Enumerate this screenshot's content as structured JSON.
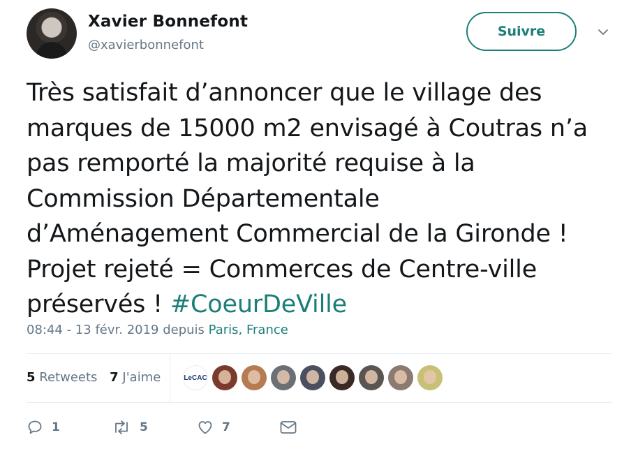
{
  "user": {
    "name": "Xavier Bonnefont",
    "handle": "@xavierbonnefont"
  },
  "follow_label": "Suivre",
  "tweet": {
    "text_lines": [
      "Très satisfait d’annoncer que le village des",
      "marques de 15000 m2 envisagé à Coutras n’a",
      "pas remporté la majorité requise à la",
      "Commission Départementale",
      "d’Aménagement Commercial de la Gironde !",
      "Projet rejeté = Commerces de Centre-ville",
      "préservés !"
    ],
    "hashtag": "#CoeurDeVille"
  },
  "meta": {
    "time": "08:44 - 13 févr. 2019 depuis ",
    "location": "Paris, France"
  },
  "stats": {
    "retweets_count": "5",
    "retweets_label": "Retweets",
    "likes_count": "7",
    "likes_label": "J'aime"
  },
  "likers": {
    "logo_text": "LeCAC",
    "avatar_colors": [
      "#7b3b2c",
      "#b57b52",
      "#6b6f76",
      "#4a5060",
      "#3a2a26",
      "#5b5552",
      "#8a7a70",
      "#c9c078"
    ]
  },
  "actions": {
    "reply_count": "1",
    "retweet_count": "5",
    "like_count": "7"
  },
  "colors": {
    "accent": "#1b7f77",
    "secondary_text": "#657786"
  }
}
